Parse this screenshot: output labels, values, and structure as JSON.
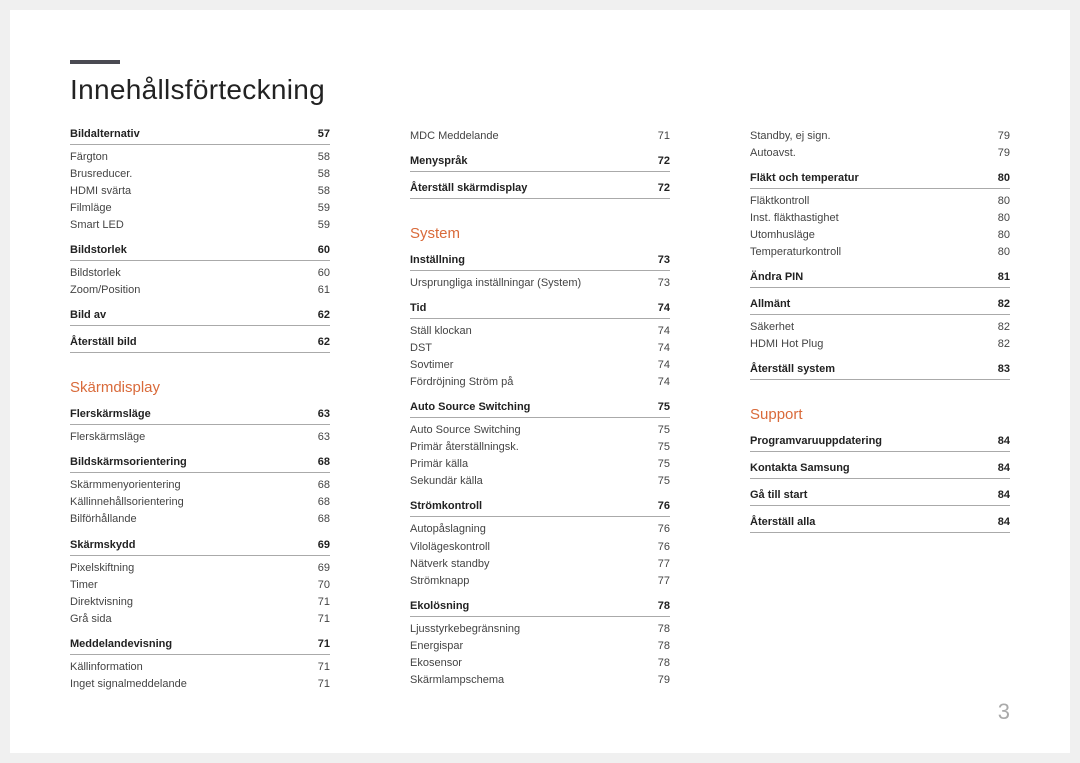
{
  "title": "Innehållsförteckning",
  "page_number": "3",
  "columns": [
    {
      "sections": [
        {
          "title": null,
          "groups": [
            {
              "head": {
                "label": "Bildalternativ",
                "page": "57"
              },
              "entries": [
                {
                  "label": "Färgton",
                  "page": "58"
                },
                {
                  "label": "Brusreducer.",
                  "page": "58"
                },
                {
                  "label": "HDMI svärta",
                  "page": "58"
                },
                {
                  "label": "Filmläge",
                  "page": "59"
                },
                {
                  "label": "Smart LED",
                  "page": "59"
                }
              ]
            },
            {
              "head": {
                "label": "Bildstorlek",
                "page": "60"
              },
              "entries": [
                {
                  "label": "Bildstorlek",
                  "page": "60"
                },
                {
                  "label": "Zoom/Position",
                  "page": "61"
                }
              ]
            },
            {
              "head": {
                "label": "Bild av",
                "page": "62"
              },
              "entries": []
            },
            {
              "head": {
                "label": "Återställ bild",
                "page": "62"
              },
              "entries": []
            }
          ]
        },
        {
          "title": "Skärmdisplay",
          "groups": [
            {
              "head": {
                "label": "Flerskärmsläge",
                "page": "63"
              },
              "entries": [
                {
                  "label": "Flerskärmsläge",
                  "page": "63"
                }
              ]
            },
            {
              "head": {
                "label": "Bildskärmsorientering",
                "page": "68"
              },
              "entries": [
                {
                  "label": "Skärmmenyorientering",
                  "page": "68"
                },
                {
                  "label": "Källinnehållsorientering",
                  "page": "68"
                },
                {
                  "label": "Bilförhållande",
                  "page": "68"
                }
              ]
            },
            {
              "head": {
                "label": "Skärmskydd",
                "page": "69"
              },
              "entries": [
                {
                  "label": "Pixelskiftning",
                  "page": "69"
                },
                {
                  "label": "Timer",
                  "page": "70"
                },
                {
                  "label": "Direktvisning",
                  "page": "71"
                },
                {
                  "label": "Grå sida",
                  "page": "71"
                }
              ]
            },
            {
              "head": {
                "label": "Meddelandevisning",
                "page": "71"
              },
              "entries": [
                {
                  "label": "Källinformation",
                  "page": "71"
                },
                {
                  "label": "Inget signalmeddelande",
                  "page": "71"
                }
              ]
            }
          ]
        }
      ]
    },
    {
      "sections": [
        {
          "title": null,
          "groups": [
            {
              "head": null,
              "entries": [
                {
                  "label": "MDC Meddelande",
                  "page": "71"
                }
              ]
            },
            {
              "head": {
                "label": "Menyspråk",
                "page": "72"
              },
              "entries": []
            },
            {
              "head": {
                "label": "Återställ skärmdisplay",
                "page": "72"
              },
              "entries": []
            }
          ]
        },
        {
          "title": "System",
          "groups": [
            {
              "head": {
                "label": "Inställning",
                "page": "73"
              },
              "entries": [
                {
                  "label": "Ursprungliga inställningar (System)",
                  "page": "73"
                }
              ]
            },
            {
              "head": {
                "label": "Tid",
                "page": "74"
              },
              "entries": [
                {
                  "label": "Ställ klockan",
                  "page": "74"
                },
                {
                  "label": "DST",
                  "page": "74"
                },
                {
                  "label": "Sovtimer",
                  "page": "74"
                },
                {
                  "label": "Fördröjning Ström på",
                  "page": "74"
                }
              ]
            },
            {
              "head": {
                "label": "Auto Source Switching",
                "page": "75"
              },
              "entries": [
                {
                  "label": "Auto Source Switching",
                  "page": "75"
                },
                {
                  "label": "Primär återställningsk.",
                  "page": "75"
                },
                {
                  "label": "Primär källa",
                  "page": "75"
                },
                {
                  "label": "Sekundär källa",
                  "page": "75"
                }
              ]
            },
            {
              "head": {
                "label": "Strömkontroll",
                "page": "76"
              },
              "entries": [
                {
                  "label": "Autopåslagning",
                  "page": "76"
                },
                {
                  "label": "Vilolägeskontroll",
                  "page": "76"
                },
                {
                  "label": "Nätverk standby",
                  "page": "77"
                },
                {
                  "label": "Strömknapp",
                  "page": "77"
                }
              ]
            },
            {
              "head": {
                "label": "Ekolösning",
                "page": "78"
              },
              "entries": [
                {
                  "label": "Ljusstyrkebegränsning",
                  "page": "78"
                },
                {
                  "label": "Energispar",
                  "page": "78"
                },
                {
                  "label": "Ekosensor",
                  "page": "78"
                },
                {
                  "label": "Skärmlampschema",
                  "page": "79"
                }
              ]
            }
          ]
        }
      ]
    },
    {
      "sections": [
        {
          "title": null,
          "groups": [
            {
              "head": null,
              "entries": [
                {
                  "label": "Standby, ej sign.",
                  "page": "79"
                },
                {
                  "label": "Autoavst.",
                  "page": "79"
                }
              ]
            },
            {
              "head": {
                "label": "Fläkt och temperatur",
                "page": "80"
              },
              "entries": [
                {
                  "label": "Fläktkontroll",
                  "page": "80"
                },
                {
                  "label": "Inst. fläkthastighet",
                  "page": "80"
                },
                {
                  "label": "Utomhusläge",
                  "page": "80"
                },
                {
                  "label": "Temperaturkontroll",
                  "page": "80"
                }
              ]
            },
            {
              "head": {
                "label": "Ändra PIN",
                "page": "81"
              },
              "entries": []
            },
            {
              "head": {
                "label": "Allmänt",
                "page": "82"
              },
              "entries": [
                {
                  "label": "Säkerhet",
                  "page": "82"
                },
                {
                  "label": "HDMI Hot Plug",
                  "page": "82"
                }
              ]
            },
            {
              "head": {
                "label": "Återställ system",
                "page": "83"
              },
              "entries": []
            }
          ]
        },
        {
          "title": "Support",
          "groups": [
            {
              "head": {
                "label": "Programvaruuppdatering",
                "page": "84"
              },
              "entries": []
            },
            {
              "head": {
                "label": "Kontakta Samsung",
                "page": "84"
              },
              "entries": []
            },
            {
              "head": {
                "label": "Gå till start",
                "page": "84"
              },
              "entries": []
            },
            {
              "head": {
                "label": "Återställ alla",
                "page": "84"
              },
              "entries": []
            }
          ]
        }
      ]
    }
  ]
}
